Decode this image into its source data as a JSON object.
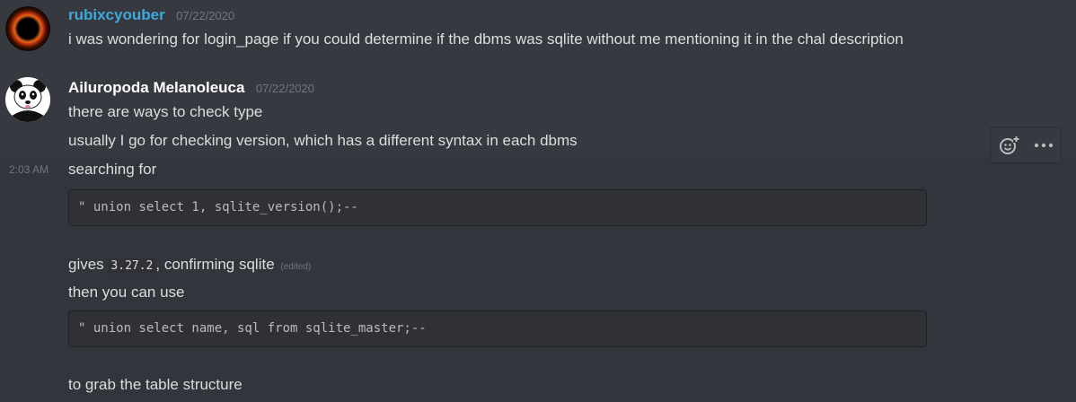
{
  "colors": {
    "username_1": "#3fa9d8",
    "username_2": "#ffffff"
  },
  "messages": [
    {
      "author": "rubixcyouber",
      "timestamp": "07/22/2020",
      "avatar_icon": "dark-ring-avatar",
      "text": "i was wondering for login_page if you could determine if the dbms was sqlite without me mentioning it in the chal description"
    },
    {
      "author": "Ailuropoda Melanoleuca",
      "timestamp": "07/22/2020",
      "avatar_icon": "panda-avatar",
      "lines": [
        "there are ways to check type",
        "usually I go for checking version, which has a different syntax in each dbms"
      ]
    }
  ],
  "hovered_message": {
    "side_time": "2:03 AM",
    "intro": "searching for",
    "code1": "\" union select 1, sqlite_version();--",
    "gives_prefix": "gives",
    "gives_code": "3.27.2",
    "gives_suffix": ", confirming sqlite",
    "edited_label": "(edited)",
    "then_text": "then you can use",
    "code2": "\" union select name, sql from sqlite_master;--",
    "closing_text": "to grab the table structure"
  },
  "toolbar": {
    "add_reaction_icon": "add-reaction-icon",
    "more_icon": "more-icon"
  }
}
